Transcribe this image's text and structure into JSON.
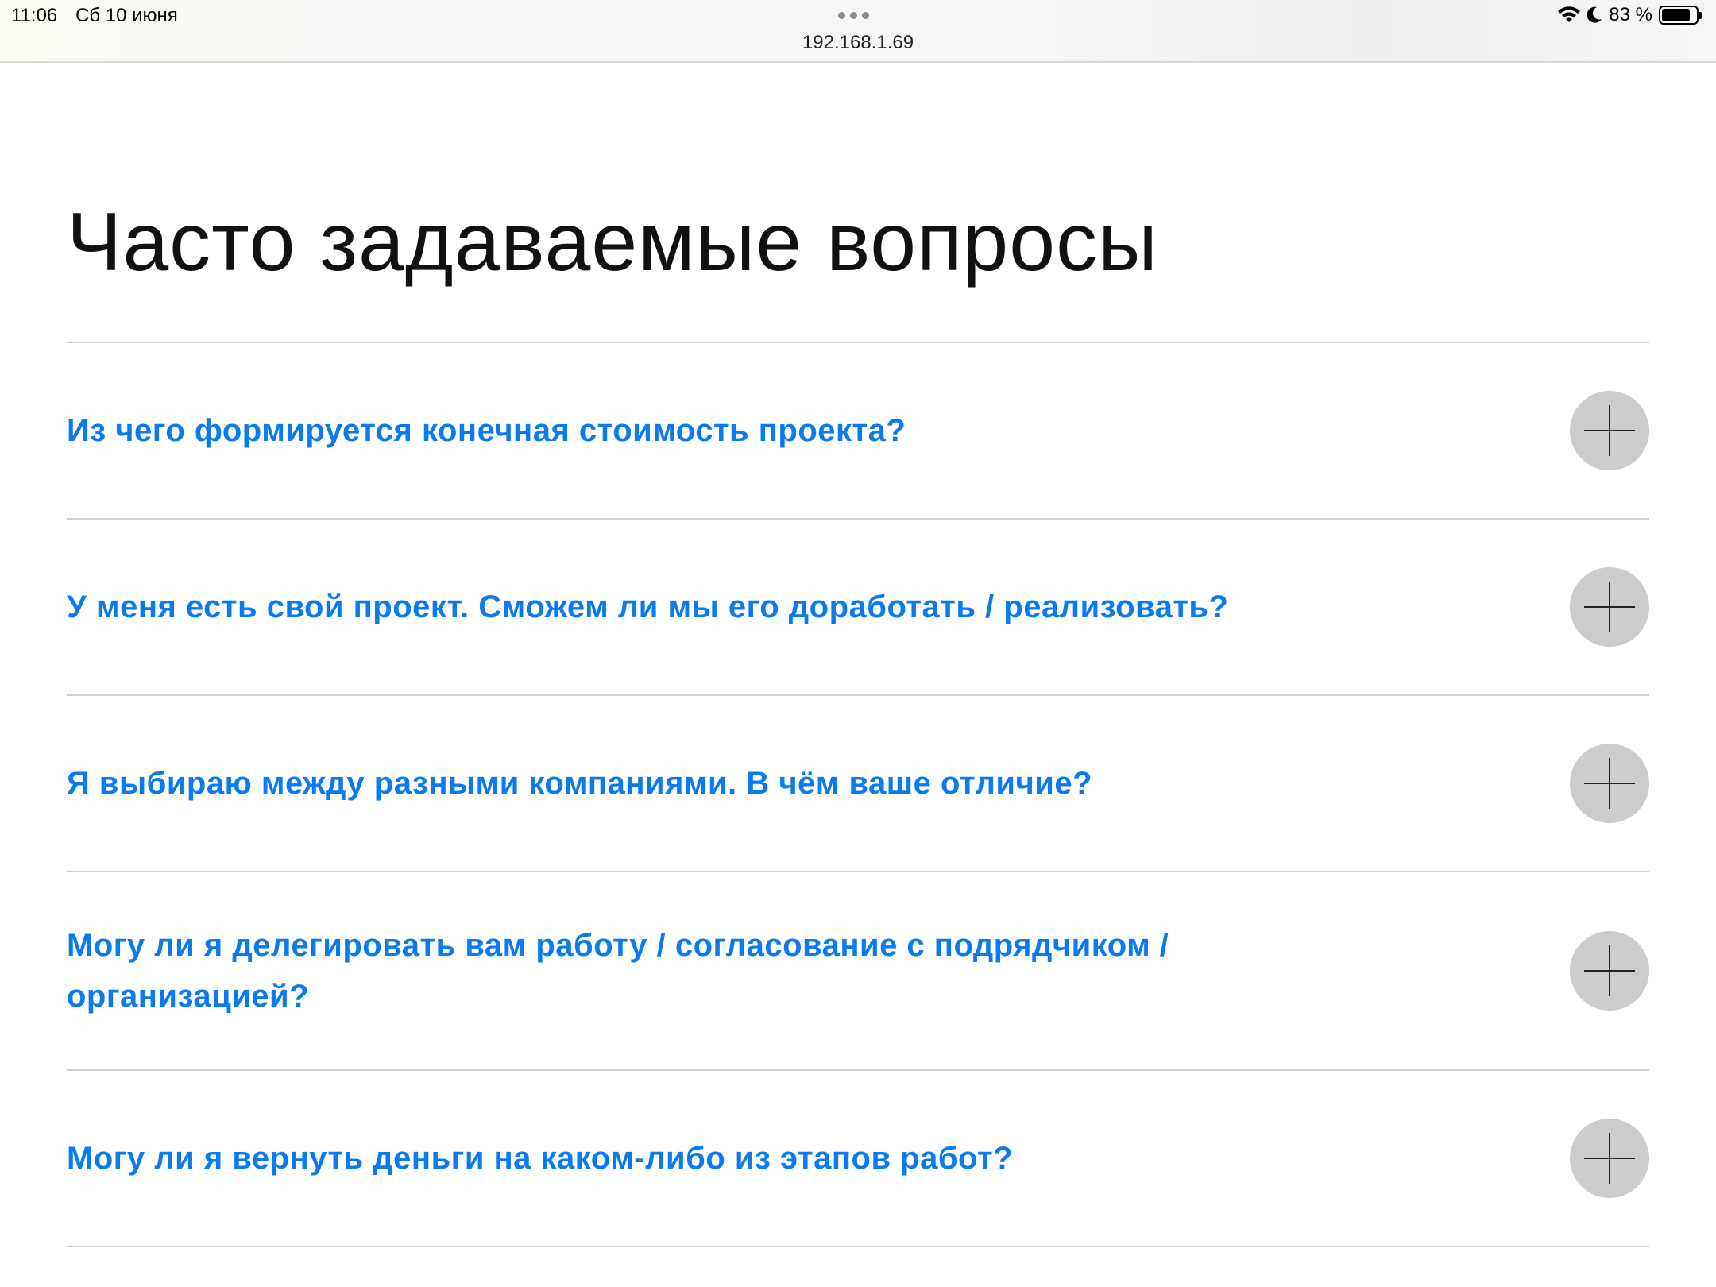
{
  "status_bar": {
    "time": "11:06",
    "date": "Сб 10 июня",
    "url": "192.168.1.69",
    "battery": "83 %",
    "battery_level": 0.83,
    "icons": [
      "wifi-icon",
      "moon-icon",
      "battery-icon"
    ]
  },
  "faq": {
    "title": "Часто задаваемые вопросы",
    "items": [
      {
        "question": "Из чего формируется конечная стоимость проекта?"
      },
      {
        "question": "У меня есть свой проект. Сможем ли мы его доработать / реализовать?"
      },
      {
        "question": "Я выбираю между разными компаниями. В чём ваше отличие?"
      },
      {
        "question": "Могу ли я делегировать вам работу / согласование с подрядчиком / организацией?"
      },
      {
        "question": "Могу ли я вернуть деньги на каком-либо из этапов работ?"
      }
    ]
  },
  "colors": {
    "question_text": "#0a7af0",
    "expand_button_bg": "#cccccc",
    "divider": "#cfcfcf"
  }
}
